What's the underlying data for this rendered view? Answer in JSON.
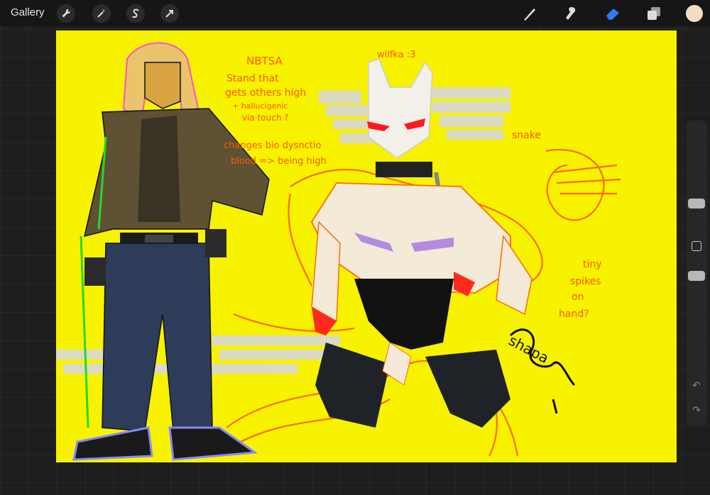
{
  "toolbar": {
    "gallery_label": "Gallery",
    "left_tools": [
      "wrench-icon",
      "magic-wand-icon",
      "selection-s-icon",
      "transform-arrow-icon"
    ],
    "right_tools": [
      "brush-icon",
      "smudge-icon",
      "eraser-icon",
      "layers-icon"
    ],
    "active_tool": "eraser-icon",
    "accent_color": "#2f7cf6",
    "current_color": "#f3dcc3"
  },
  "canvas": {
    "background_color": "#f7f200",
    "notes": {
      "title_left": "NBTSA",
      "title_right": "wilfka :3",
      "line1": "Stand that",
      "line2": "gets others high",
      "line3": "+ hallucigenic",
      "line4": "via touch ?",
      "line5": "changes bio dysnctio",
      "line6": "blood => being high",
      "snake": "snake",
      "side1": "tiny",
      "side2": "spikes",
      "side3": "on",
      "side4": "hand?",
      "signature": "shapa"
    }
  },
  "sidebar": {
    "size_slider_level": 0.28,
    "opacity_slider_level": 0.52
  }
}
